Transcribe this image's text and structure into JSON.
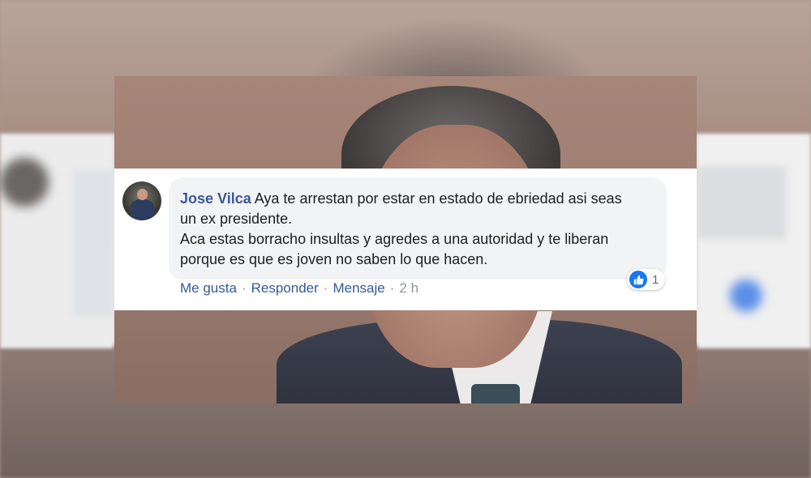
{
  "comment": {
    "author": "Jose Vilca",
    "text_lines": [
      "Aya te arrestan por estar en estado de ebriedad asi seas",
      "un ex presidente.",
      "Aca estas borracho insultas y agredes a una autoridad y te liberan",
      "porque es que es joven no saben lo que hacen."
    ],
    "reaction": {
      "icon": "like-icon",
      "count": "1",
      "color": "#1877f2"
    },
    "actions": {
      "like": "Me gusta",
      "reply": "Responder",
      "message": "Mensaje",
      "separator": "·",
      "time": "2 h"
    },
    "author_color": "#385898"
  }
}
